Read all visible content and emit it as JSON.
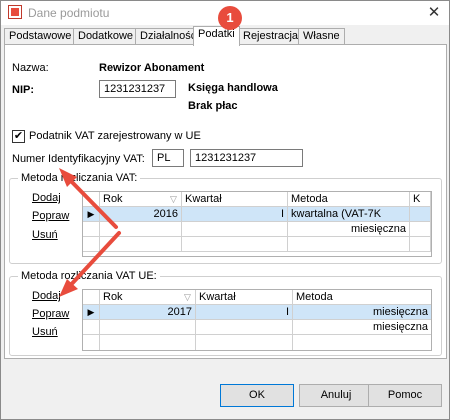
{
  "window": {
    "title": "Dane podmiotu",
    "close_glyph": "✕"
  },
  "tabs": [
    {
      "label": "Podstawowe"
    },
    {
      "label": "Dodatkowe"
    },
    {
      "label": "Działalność"
    },
    {
      "label": "Podatki"
    },
    {
      "label": "Rejestracja"
    },
    {
      "label": "Własne"
    }
  ],
  "active_tab": "Podatki",
  "annotation": {
    "badge": "1",
    "color": "#e84c3d"
  },
  "form": {
    "nazwa_label": "Nazwa:",
    "nazwa_value": "Rewizor Abonament",
    "nip_label": "NIP:",
    "nip_value": "1231231237",
    "ksiega": "Księga handlowa",
    "brak_plac": "Brak płac",
    "vat_ue_checkbox_label": "Podatnik VAT zarejestrowany w UE",
    "vat_ue_checked": true,
    "vat_id_label": "Numer Identyfikacyjny VAT:",
    "vat_country": "PL",
    "vat_number": "1231231237"
  },
  "vat_section": {
    "title": "Metoda rozliczania VAT:",
    "links": {
      "add": "Dodaj",
      "edit": "Popraw",
      "delete": "Usuń"
    },
    "columns": [
      "Rok",
      "Kwartał",
      "Metoda",
      "K"
    ],
    "rows": [
      {
        "rok": "2016",
        "kwartal": "I",
        "metoda": "kwartalna  (VAT-7K"
      },
      {
        "rok": "",
        "kwartal": "",
        "metoda": "miesięczna"
      }
    ]
  },
  "vat_ue_section": {
    "title": "Metoda rozliczania VAT UE:",
    "links": {
      "add": "Dodaj",
      "edit": "Popraw",
      "delete": "Usuń"
    },
    "columns": [
      "Rok",
      "Kwartał",
      "Metoda"
    ],
    "rows": [
      {
        "rok": "2017",
        "kwartal": "I",
        "metoda": "miesięczna"
      },
      {
        "rok": "",
        "kwartal": "",
        "metoda": "miesięczna"
      }
    ]
  },
  "buttons": {
    "ok": "OK",
    "cancel": "Anuluj",
    "help": "Pomoc"
  }
}
